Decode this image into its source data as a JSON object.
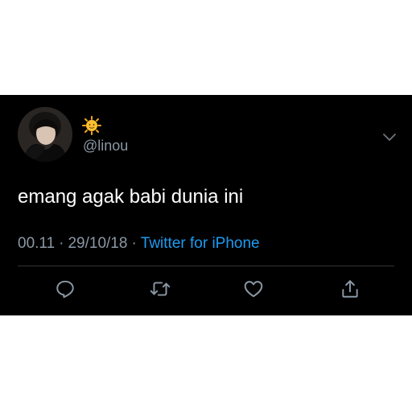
{
  "tweet": {
    "handle": "@linou",
    "name_emoji_icon": "sun-face-emoji",
    "text": "emang agak babi dunia ini",
    "time": "00.11",
    "separator": "·",
    "date": "29/10/18",
    "source": "Twitter for iPhone"
  },
  "actions": {
    "icons": [
      "reply-icon",
      "retweet-icon",
      "like-icon",
      "share-icon"
    ]
  },
  "colors": {
    "card_background": "#000000",
    "page_background": "#ffffff",
    "text_primary": "#ffffff",
    "text_secondary": "#8b98a5",
    "link": "#1d9bf0",
    "divider": "#2f3336"
  }
}
